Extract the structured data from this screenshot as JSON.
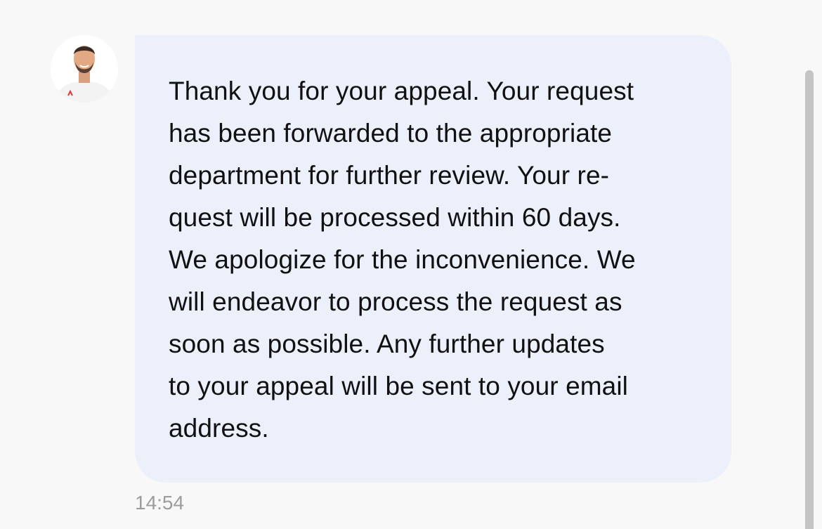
{
  "conversation": {
    "incoming_message": {
      "avatar_icon": "person-avatar-icon",
      "text": "Thank you for your appeal. Your request\nhas been forwarded to the appropriate\ndepartment for further review. Your re-\nquest will be processed within 60 days.\nWe apologize for the inconvenience. We\nwill endeavor to process the request as\nsoon as possible. Any further updates\nto your appeal will be sent to your email\naddress.",
      "time": "14:54"
    }
  },
  "colors": {
    "page_background": "#f8f8f8",
    "bubble_background": "#ebf0fb",
    "message_text": "#111111",
    "timestamp_text": "#9c9c9c",
    "scrollbar": "#c4c4c4"
  }
}
